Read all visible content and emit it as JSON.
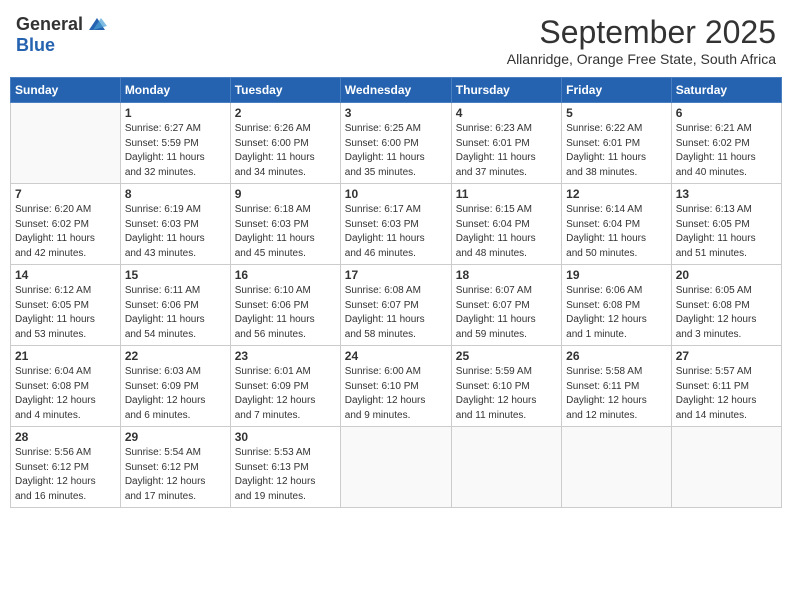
{
  "header": {
    "logo_general": "General",
    "logo_blue": "Blue",
    "month_title": "September 2025",
    "subtitle": "Allanridge, Orange Free State, South Africa"
  },
  "days_of_week": [
    "Sunday",
    "Monday",
    "Tuesday",
    "Wednesday",
    "Thursday",
    "Friday",
    "Saturday"
  ],
  "weeks": [
    [
      {
        "day": "",
        "info": ""
      },
      {
        "day": "1",
        "info": "Sunrise: 6:27 AM\nSunset: 5:59 PM\nDaylight: 11 hours\nand 32 minutes."
      },
      {
        "day": "2",
        "info": "Sunrise: 6:26 AM\nSunset: 6:00 PM\nDaylight: 11 hours\nand 34 minutes."
      },
      {
        "day": "3",
        "info": "Sunrise: 6:25 AM\nSunset: 6:00 PM\nDaylight: 11 hours\nand 35 minutes."
      },
      {
        "day": "4",
        "info": "Sunrise: 6:23 AM\nSunset: 6:01 PM\nDaylight: 11 hours\nand 37 minutes."
      },
      {
        "day": "5",
        "info": "Sunrise: 6:22 AM\nSunset: 6:01 PM\nDaylight: 11 hours\nand 38 minutes."
      },
      {
        "day": "6",
        "info": "Sunrise: 6:21 AM\nSunset: 6:02 PM\nDaylight: 11 hours\nand 40 minutes."
      }
    ],
    [
      {
        "day": "7",
        "info": "Sunrise: 6:20 AM\nSunset: 6:02 PM\nDaylight: 11 hours\nand 42 minutes."
      },
      {
        "day": "8",
        "info": "Sunrise: 6:19 AM\nSunset: 6:03 PM\nDaylight: 11 hours\nand 43 minutes."
      },
      {
        "day": "9",
        "info": "Sunrise: 6:18 AM\nSunset: 6:03 PM\nDaylight: 11 hours\nand 45 minutes."
      },
      {
        "day": "10",
        "info": "Sunrise: 6:17 AM\nSunset: 6:03 PM\nDaylight: 11 hours\nand 46 minutes."
      },
      {
        "day": "11",
        "info": "Sunrise: 6:15 AM\nSunset: 6:04 PM\nDaylight: 11 hours\nand 48 minutes."
      },
      {
        "day": "12",
        "info": "Sunrise: 6:14 AM\nSunset: 6:04 PM\nDaylight: 11 hours\nand 50 minutes."
      },
      {
        "day": "13",
        "info": "Sunrise: 6:13 AM\nSunset: 6:05 PM\nDaylight: 11 hours\nand 51 minutes."
      }
    ],
    [
      {
        "day": "14",
        "info": "Sunrise: 6:12 AM\nSunset: 6:05 PM\nDaylight: 11 hours\nand 53 minutes."
      },
      {
        "day": "15",
        "info": "Sunrise: 6:11 AM\nSunset: 6:06 PM\nDaylight: 11 hours\nand 54 minutes."
      },
      {
        "day": "16",
        "info": "Sunrise: 6:10 AM\nSunset: 6:06 PM\nDaylight: 11 hours\nand 56 minutes."
      },
      {
        "day": "17",
        "info": "Sunrise: 6:08 AM\nSunset: 6:07 PM\nDaylight: 11 hours\nand 58 minutes."
      },
      {
        "day": "18",
        "info": "Sunrise: 6:07 AM\nSunset: 6:07 PM\nDaylight: 11 hours\nand 59 minutes."
      },
      {
        "day": "19",
        "info": "Sunrise: 6:06 AM\nSunset: 6:08 PM\nDaylight: 12 hours\nand 1 minute."
      },
      {
        "day": "20",
        "info": "Sunrise: 6:05 AM\nSunset: 6:08 PM\nDaylight: 12 hours\nand 3 minutes."
      }
    ],
    [
      {
        "day": "21",
        "info": "Sunrise: 6:04 AM\nSunset: 6:08 PM\nDaylight: 12 hours\nand 4 minutes."
      },
      {
        "day": "22",
        "info": "Sunrise: 6:03 AM\nSunset: 6:09 PM\nDaylight: 12 hours\nand 6 minutes."
      },
      {
        "day": "23",
        "info": "Sunrise: 6:01 AM\nSunset: 6:09 PM\nDaylight: 12 hours\nand 7 minutes."
      },
      {
        "day": "24",
        "info": "Sunrise: 6:00 AM\nSunset: 6:10 PM\nDaylight: 12 hours\nand 9 minutes."
      },
      {
        "day": "25",
        "info": "Sunrise: 5:59 AM\nSunset: 6:10 PM\nDaylight: 12 hours\nand 11 minutes."
      },
      {
        "day": "26",
        "info": "Sunrise: 5:58 AM\nSunset: 6:11 PM\nDaylight: 12 hours\nand 12 minutes."
      },
      {
        "day": "27",
        "info": "Sunrise: 5:57 AM\nSunset: 6:11 PM\nDaylight: 12 hours\nand 14 minutes."
      }
    ],
    [
      {
        "day": "28",
        "info": "Sunrise: 5:56 AM\nSunset: 6:12 PM\nDaylight: 12 hours\nand 16 minutes."
      },
      {
        "day": "29",
        "info": "Sunrise: 5:54 AM\nSunset: 6:12 PM\nDaylight: 12 hours\nand 17 minutes."
      },
      {
        "day": "30",
        "info": "Sunrise: 5:53 AM\nSunset: 6:13 PM\nDaylight: 12 hours\nand 19 minutes."
      },
      {
        "day": "",
        "info": ""
      },
      {
        "day": "",
        "info": ""
      },
      {
        "day": "",
        "info": ""
      },
      {
        "day": "",
        "info": ""
      }
    ]
  ]
}
